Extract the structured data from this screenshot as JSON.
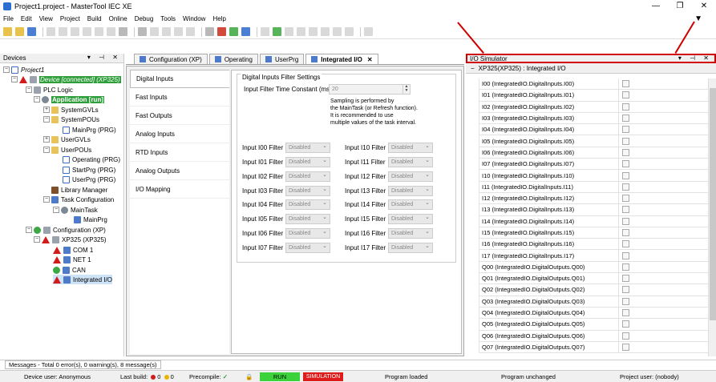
{
  "window": {
    "title": "Project1.project - MasterTool IEC XE"
  },
  "menu": [
    "File",
    "Edit",
    "View",
    "Project",
    "Build",
    "Online",
    "Debug",
    "Tools",
    "Window",
    "Help"
  ],
  "devices": {
    "title": "Devices",
    "nodes": [
      "Project1",
      "Device [connected] (XP325)",
      "PLC Logic",
      "Application [run]",
      "SystemGVLs",
      "SystemPOUs",
      "MainPrg (PRG)",
      "UserGVLs",
      "UserPOUs",
      "Operating (PRG)",
      "StartPrg (PRG)",
      "UserPrg (PRG)",
      "Library Manager",
      "Task Configuration",
      "MainTask",
      "MainPrg",
      "Configuration (XP)",
      "XP325 (XP325)",
      "COM 1",
      "NET 1",
      "CAN",
      "Integrated I/O"
    ]
  },
  "editor": {
    "tabs": [
      "Configuration (XP)",
      "Operating",
      "UserPrg",
      "Integrated I/O"
    ],
    "sidetabs": [
      "Digital Inputs",
      "Fast Inputs",
      "Fast Outputs",
      "Analog Inputs",
      "RTD Inputs",
      "Analog Outputs",
      "I/O Mapping"
    ],
    "group_title": "Digital Inputs Filter Settings",
    "time_constant_label": "Input Filter Time Constant (ms)",
    "time_constant_value": "20",
    "note": [
      "Sampling is performed by",
      "the MainTask (or Refresh function).",
      "It is recommended to use",
      "multiple values of the task interval."
    ],
    "filters_left": [
      "Input I00 Filter",
      "Input I01 Filter",
      "Input I02 Filter",
      "Input I03 Filter",
      "Input I04 Filter",
      "Input I05 Filter",
      "Input I06 Filter",
      "Input I07 Filter"
    ],
    "filters_right": [
      "Input I10 Filter",
      "Input I11 Filter",
      "Input I12 Filter",
      "Input I13 Filter",
      "Input I14 Filter",
      "Input I15 Filter",
      "Input I16 Filter",
      "Input I17 Filter"
    ],
    "filter_value": "Disabled"
  },
  "io_simulator": {
    "title": "I/O Simulator",
    "subtitle": "XP325(XP325) : Integrated I/O",
    "rows": [
      "I00 (IntegratedIO.DigitalInputs.I00)",
      "I01 (IntegratedIO.DigitalInputs.I01)",
      "I02 (IntegratedIO.DigitalInputs.I02)",
      "I03 (IntegratedIO.DigitalInputs.I03)",
      "I04 (IntegratedIO.DigitalInputs.I04)",
      "I05 (IntegratedIO.DigitalInputs.I05)",
      "I06 (IntegratedIO.DigitalInputs.I06)",
      "I07 (IntegratedIO.DigitalInputs.I07)",
      "I10 (IntegratedIO.DigitalInputs.I10)",
      "I11 (IntegratedIO.DigitalInputs.I11)",
      "I12 (IntegratedIO.DigitalInputs.I12)",
      "I13 (IntegratedIO.DigitalInputs.I13)",
      "I14 (IntegratedIO.DigitalInputs.I14)",
      "I15 (IntegratedIO.DigitalInputs.I15)",
      "I16 (IntegratedIO.DigitalInputs.I16)",
      "I17 (IntegratedIO.DigitalInputs.I17)",
      "Q00 (IntegratedIO.DigitalOutputs.Q00)",
      "Q01 (IntegratedIO.DigitalOutputs.Q01)",
      "Q02 (IntegratedIO.DigitalOutputs.Q02)",
      "Q03 (IntegratedIO.DigitalOutputs.Q03)",
      "Q04 (IntegratedIO.DigitalOutputs.Q04)",
      "Q05 (IntegratedIO.DigitalOutputs.Q05)",
      "Q06 (IntegratedIO.DigitalOutputs.Q06)",
      "Q07 (IntegratedIO.DigitalOutputs.Q07)"
    ]
  },
  "messages": "Messages - Total 0 error(s), 0 warning(s), 8 message(s)",
  "status": {
    "device_user": "Device user: Anonymous",
    "last_build": "Last build:",
    "errors": "0",
    "warnings": "0",
    "precompile": "Precompile:",
    "run": "RUN",
    "simulation": "SIMULATION",
    "program_loaded": "Program loaded",
    "program_unchanged": "Program unchanged",
    "project_user": "Project user: (nobody)"
  },
  "colors": {
    "accent_red": "#d10000",
    "run_green": "#3bd23b",
    "sim_red": "#e01b1b"
  }
}
